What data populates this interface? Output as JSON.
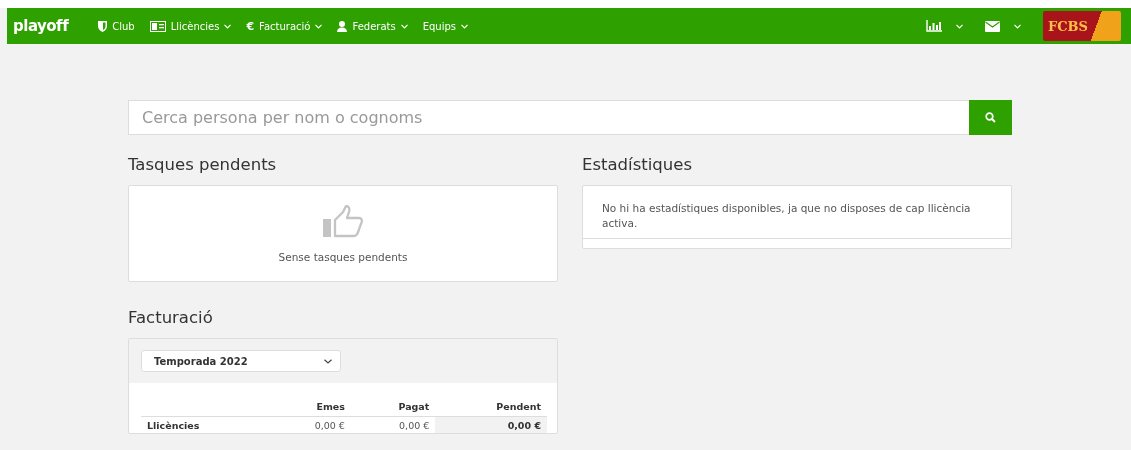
{
  "navbar": {
    "brand": "playoff",
    "items": [
      {
        "label": "Club",
        "dropdown": false
      },
      {
        "label": "Llicències",
        "dropdown": true
      },
      {
        "label": "Facturació",
        "glyph": "€",
        "dropdown": true
      },
      {
        "label": "Federats",
        "dropdown": true
      },
      {
        "label": "Equips",
        "dropdown": true
      }
    ],
    "right": [
      {
        "dropdown": true
      },
      {
        "dropdown": true
      }
    ],
    "logo": {
      "text": "FCBS"
    }
  },
  "search": {
    "placeholder": "Cerca persona per nom o cognoms"
  },
  "tasks": {
    "title": "Tasques pendents",
    "empty": "Sense tasques pendents"
  },
  "stats": {
    "title": "Estadístiques",
    "message": "No hi ha estadístiques disponibles, ja que no disposes de cap llicència activa."
  },
  "billing": {
    "title": "Facturació",
    "season": "Temporada 2022",
    "columns": [
      "Emes",
      "Pagat",
      "Pendent"
    ],
    "rows": [
      {
        "label": "Llicències",
        "cells": [
          "0,00 €",
          "0,00 €",
          "0,00 €"
        ]
      }
    ]
  }
}
